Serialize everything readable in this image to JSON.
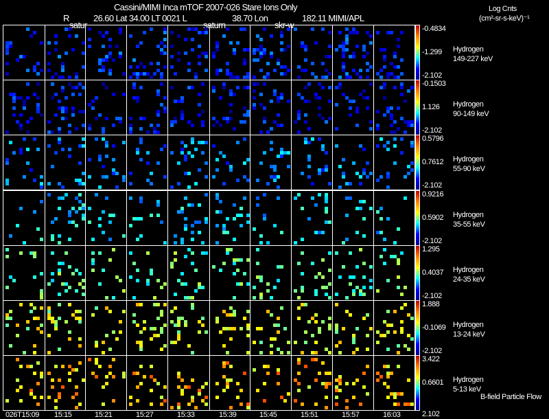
{
  "header": {
    "title": "Cassini/MIMI Inca mTOF  2007-026   Stare   Ions Only",
    "r_label": "R",
    "coords": "26.60 Lat 34.00 LT 0021 L",
    "l_val": "38.70 Lon",
    "lon_val": "182.11  MIMI/APL",
    "units_title": "Log Cnts",
    "units": "(cm²-sr-s-keV)⁻¹",
    "markers": [
      "satur",
      "saturn",
      "skr-w"
    ]
  },
  "footer_note": "B-field Particle Flow",
  "chart_data": {
    "type": "heatmap",
    "title": "Cassini/MIMI Inca mTOF 2007-026 Stare Ions Only",
    "x_ticks": [
      "026T15:09",
      "15:15",
      "15:21",
      "15:27",
      "15:33",
      "15:39",
      "15:45",
      "15:51",
      "15:57",
      "16:03"
    ],
    "colormap": [
      "#00008f",
      "#0000ff",
      "#00ffff",
      "#ffff00",
      "#ff8000",
      "#c00000"
    ],
    "panels": [
      {
        "species": "Hydrogen",
        "energy": "149-227 keV",
        "max": "-0.4834",
        "mid": "-1.299",
        "min": "-2.102",
        "level": 0.15,
        "density": 0.18
      },
      {
        "species": "Hydrogen",
        "energy": "90-149 keV",
        "max": "-0.1503",
        "mid": "1.126",
        "min": "-2.102",
        "level": 0.12,
        "density": 0.16
      },
      {
        "species": "Hydrogen",
        "energy": "55-90 keV",
        "max": "0.5796",
        "mid": "0.7612",
        "min": "-2.102",
        "level": 0.25,
        "density": 0.1
      },
      {
        "species": "Hydrogen",
        "energy": "35-55 keV",
        "max": "0.9216",
        "mid": "0.5902",
        "min": "-2.102",
        "level": 0.33,
        "density": 0.1
      },
      {
        "species": "Hydrogen",
        "energy": "24-35 keV",
        "max": "1.295",
        "mid": "0.4037",
        "min": "-2.102",
        "level": 0.45,
        "density": 0.1
      },
      {
        "species": "Hydrogen",
        "energy": "13-24 keV",
        "max": "1.888",
        "mid": "-0.1069",
        "min": "-2.102",
        "level": 0.58,
        "density": 0.14
      },
      {
        "species": "Hydrogen",
        "energy": "5-13 keV",
        "max": "3.422",
        "mid": "0.6601",
        "min": "2.102",
        "level": 0.68,
        "density": 0.12
      }
    ]
  }
}
